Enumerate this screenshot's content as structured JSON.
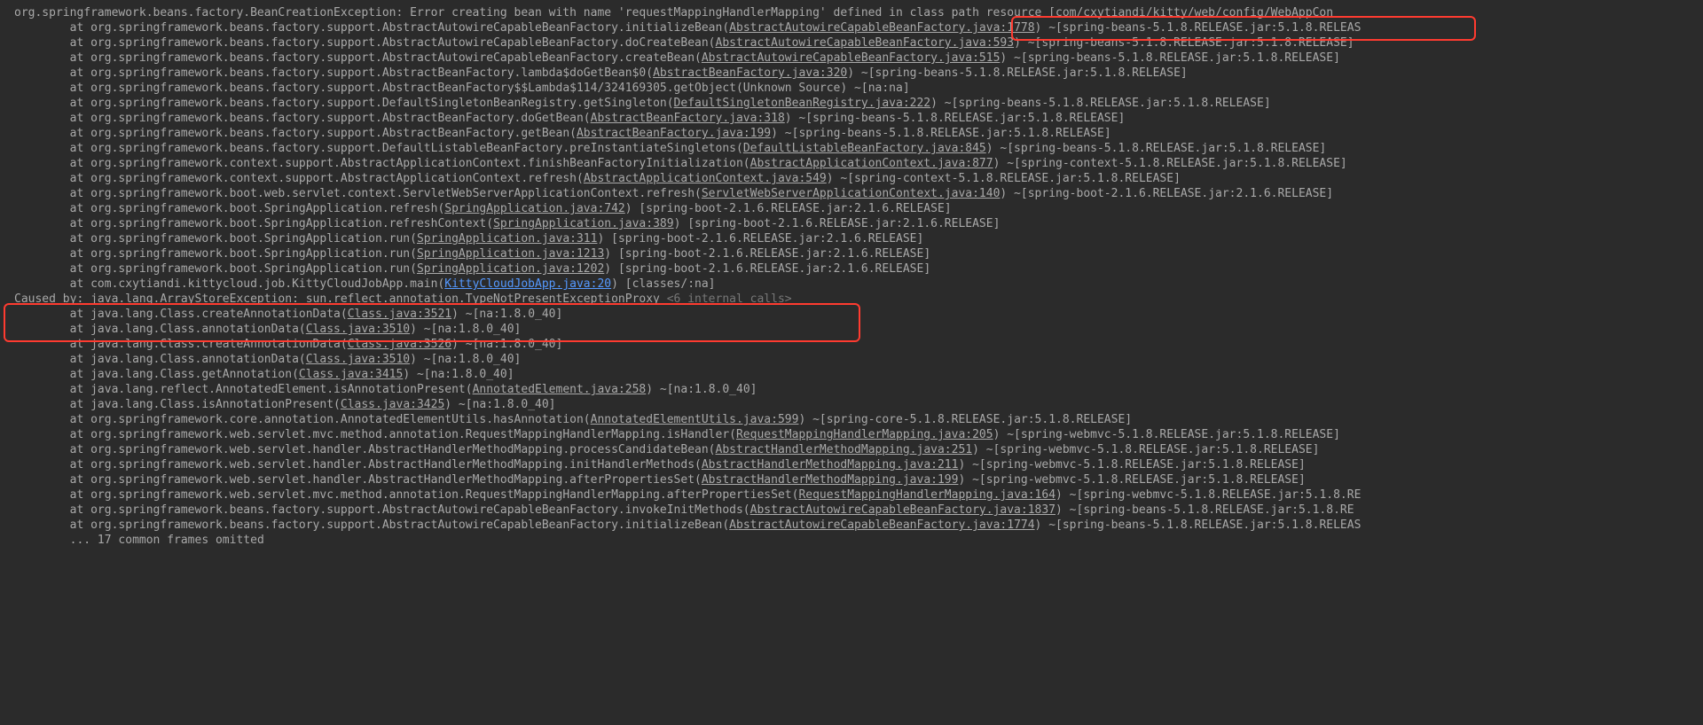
{
  "lines": [
    {
      "indent": 0,
      "segments": [
        {
          "t": "org.springframework.beans.factory.BeanCreationException: Error creating bean with name 'requestMappingHandlerMapping' defined in class path resource [com/cxytiandi/kitty/web/config/WebAppCon"
        }
      ]
    },
    {
      "indent": 2,
      "segments": [
        {
          "t": "at org.springframework.beans.factory.support.AbstractAutowireCapableBeanFactory.initializeBean("
        },
        {
          "t": "AbstractAutowireCapableBeanFactory.java:1778",
          "link": true
        },
        {
          "t": ") ~[spring-beans-5.1.8.RELEASE.jar:5.1.8.RELEAS"
        }
      ]
    },
    {
      "indent": 2,
      "segments": [
        {
          "t": "at org.springframework.beans.factory.support.AbstractAutowireCapableBeanFactory.doCreateBean("
        },
        {
          "t": "AbstractAutowireCapableBeanFactory.java:593",
          "link": true
        },
        {
          "t": ") ~[spring-beans-5.1.8.RELEASE.jar:5.1.8.RELEASE]"
        }
      ]
    },
    {
      "indent": 2,
      "segments": [
        {
          "t": "at org.springframework.beans.factory.support.AbstractAutowireCapableBeanFactory.createBean("
        },
        {
          "t": "AbstractAutowireCapableBeanFactory.java:515",
          "link": true
        },
        {
          "t": ") ~[spring-beans-5.1.8.RELEASE.jar:5.1.8.RELEASE]"
        }
      ]
    },
    {
      "indent": 2,
      "segments": [
        {
          "t": "at org.springframework.beans.factory.support.AbstractBeanFactory.lambda$doGetBean$0("
        },
        {
          "t": "AbstractBeanFactory.java:320",
          "link": true
        },
        {
          "t": ") ~[spring-beans-5.1.8.RELEASE.jar:5.1.8.RELEASE]"
        }
      ]
    },
    {
      "indent": 2,
      "segments": [
        {
          "t": "at org.springframework.beans.factory.support.AbstractBeanFactory$$Lambda$114/324169305.getObject(Unknown Source) ~[na:na]"
        }
      ]
    },
    {
      "indent": 2,
      "segments": [
        {
          "t": "at org.springframework.beans.factory.support.DefaultSingletonBeanRegistry.getSingleton("
        },
        {
          "t": "DefaultSingletonBeanRegistry.java:222",
          "link": true
        },
        {
          "t": ") ~[spring-beans-5.1.8.RELEASE.jar:5.1.8.RELEASE]"
        }
      ]
    },
    {
      "indent": 2,
      "segments": [
        {
          "t": "at org.springframework.beans.factory.support.AbstractBeanFactory.doGetBean("
        },
        {
          "t": "AbstractBeanFactory.java:318",
          "link": true
        },
        {
          "t": ") ~[spring-beans-5.1.8.RELEASE.jar:5.1.8.RELEASE]"
        }
      ]
    },
    {
      "indent": 2,
      "segments": [
        {
          "t": "at org.springframework.beans.factory.support.AbstractBeanFactory.getBean("
        },
        {
          "t": "AbstractBeanFactory.java:199",
          "link": true
        },
        {
          "t": ") ~[spring-beans-5.1.8.RELEASE.jar:5.1.8.RELEASE]"
        }
      ]
    },
    {
      "indent": 2,
      "segments": [
        {
          "t": "at org.springframework.beans.factory.support.DefaultListableBeanFactory.preInstantiateSingletons("
        },
        {
          "t": "DefaultListableBeanFactory.java:845",
          "link": true
        },
        {
          "t": ") ~[spring-beans-5.1.8.RELEASE.jar:5.1.8.RELEASE]"
        }
      ]
    },
    {
      "indent": 2,
      "segments": [
        {
          "t": "at org.springframework.context.support.AbstractApplicationContext.finishBeanFactoryInitialization("
        },
        {
          "t": "AbstractApplicationContext.java:877",
          "link": true
        },
        {
          "t": ") ~[spring-context-5.1.8.RELEASE.jar:5.1.8.RELEASE]"
        }
      ]
    },
    {
      "indent": 2,
      "segments": [
        {
          "t": "at org.springframework.context.support.AbstractApplicationContext.refresh("
        },
        {
          "t": "AbstractApplicationContext.java:549",
          "link": true
        },
        {
          "t": ") ~[spring-context-5.1.8.RELEASE.jar:5.1.8.RELEASE]"
        }
      ]
    },
    {
      "indent": 2,
      "segments": [
        {
          "t": "at org.springframework.boot.web.servlet.context.ServletWebServerApplicationContext.refresh("
        },
        {
          "t": "ServletWebServerApplicationContext.java:140",
          "link": true
        },
        {
          "t": ") ~[spring-boot-2.1.6.RELEASE.jar:2.1.6.RELEASE]"
        }
      ]
    },
    {
      "indent": 2,
      "segments": [
        {
          "t": "at org.springframework.boot.SpringApplication.refresh("
        },
        {
          "t": "SpringApplication.java:742",
          "link": true
        },
        {
          "t": ") [spring-boot-2.1.6.RELEASE.jar:2.1.6.RELEASE]"
        }
      ]
    },
    {
      "indent": 2,
      "segments": [
        {
          "t": "at org.springframework.boot.SpringApplication.refreshContext("
        },
        {
          "t": "SpringApplication.java:389",
          "link": true
        },
        {
          "t": ") [spring-boot-2.1.6.RELEASE.jar:2.1.6.RELEASE]"
        }
      ]
    },
    {
      "indent": 2,
      "segments": [
        {
          "t": "at org.springframework.boot.SpringApplication.run("
        },
        {
          "t": "SpringApplication.java:311",
          "link": true
        },
        {
          "t": ") [spring-boot-2.1.6.RELEASE.jar:2.1.6.RELEASE]"
        }
      ]
    },
    {
      "indent": 2,
      "segments": [
        {
          "t": "at org.springframework.boot.SpringApplication.run("
        },
        {
          "t": "SpringApplication.java:1213",
          "link": true
        },
        {
          "t": ") [spring-boot-2.1.6.RELEASE.jar:2.1.6.RELEASE]"
        }
      ]
    },
    {
      "indent": 2,
      "segments": [
        {
          "t": "at org.springframework.boot.SpringApplication.run("
        },
        {
          "t": "SpringApplication.java:1202",
          "link": true
        },
        {
          "t": ") [spring-boot-2.1.6.RELEASE.jar:2.1.6.RELEASE]"
        }
      ]
    },
    {
      "indent": 2,
      "segments": [
        {
          "t": "at com.cxytiandi.kittycloud.job.KittyCloudJobApp.main("
        },
        {
          "t": "KittyCloudJobApp.java:20",
          "linkBlue": true
        },
        {
          "t": ") [classes/:na]"
        }
      ]
    },
    {
      "indent": 0,
      "segments": [
        {
          "t": "Caused by: java.lang.ArrayStoreException: sun.reflect.annotation.TypeNotPresentExceptionProxy "
        },
        {
          "t": "<6 internal calls>",
          "faint": true
        }
      ]
    },
    {
      "indent": 2,
      "segments": [
        {
          "t": "at java.lang.Class.createAnnotationData("
        },
        {
          "t": "Class.java:3521",
          "link": true
        },
        {
          "t": ") ~[na:1.8.0_40]"
        }
      ]
    },
    {
      "indent": 2,
      "segments": [
        {
          "t": "at java.lang.Class.annotationData("
        },
        {
          "t": "Class.java:3510",
          "link": true
        },
        {
          "t": ") ~[na:1.8.0_40]"
        }
      ]
    },
    {
      "indent": 2,
      "segments": [
        {
          "t": "at java.lang.Class.createAnnotationData("
        },
        {
          "t": "Class.java:3526",
          "link": true
        },
        {
          "t": ") ~[na:1.8.0_40]"
        }
      ]
    },
    {
      "indent": 2,
      "segments": [
        {
          "t": "at java.lang.Class.annotationData("
        },
        {
          "t": "Class.java:3510",
          "link": true
        },
        {
          "t": ") ~[na:1.8.0_40]"
        }
      ]
    },
    {
      "indent": 2,
      "segments": [
        {
          "t": "at java.lang.Class.getAnnotation("
        },
        {
          "t": "Class.java:3415",
          "link": true
        },
        {
          "t": ") ~[na:1.8.0_40]"
        }
      ]
    },
    {
      "indent": 2,
      "segments": [
        {
          "t": "at java.lang.reflect.AnnotatedElement.isAnnotationPresent("
        },
        {
          "t": "AnnotatedElement.java:258",
          "link": true
        },
        {
          "t": ") ~[na:1.8.0_40]"
        }
      ]
    },
    {
      "indent": 2,
      "segments": [
        {
          "t": "at java.lang.Class.isAnnotationPresent("
        },
        {
          "t": "Class.java:3425",
          "link": true
        },
        {
          "t": ") ~[na:1.8.0_40]"
        }
      ]
    },
    {
      "indent": 2,
      "segments": [
        {
          "t": "at org.springframework.core.annotation.AnnotatedElementUtils.hasAnnotation("
        },
        {
          "t": "AnnotatedElementUtils.java:599",
          "link": true
        },
        {
          "t": ") ~[spring-core-5.1.8.RELEASE.jar:5.1.8.RELEASE]"
        }
      ]
    },
    {
      "indent": 2,
      "segments": [
        {
          "t": "at org.springframework.web.servlet.mvc.method.annotation.RequestMappingHandlerMapping.isHandler("
        },
        {
          "t": "RequestMappingHandlerMapping.java:205",
          "link": true
        },
        {
          "t": ") ~[spring-webmvc-5.1.8.RELEASE.jar:5.1.8.RELEASE]"
        }
      ]
    },
    {
      "indent": 2,
      "segments": [
        {
          "t": "at org.springframework.web.servlet.handler.AbstractHandlerMethodMapping.processCandidateBean("
        },
        {
          "t": "AbstractHandlerMethodMapping.java:251",
          "link": true
        },
        {
          "t": ") ~[spring-webmvc-5.1.8.RELEASE.jar:5.1.8.RELEASE]"
        }
      ]
    },
    {
      "indent": 2,
      "segments": [
        {
          "t": "at org.springframework.web.servlet.handler.AbstractHandlerMethodMapping.initHandlerMethods("
        },
        {
          "t": "AbstractHandlerMethodMapping.java:211",
          "link": true
        },
        {
          "t": ") ~[spring-webmvc-5.1.8.RELEASE.jar:5.1.8.RELEASE]"
        }
      ]
    },
    {
      "indent": 2,
      "segments": [
        {
          "t": "at org.springframework.web.servlet.handler.AbstractHandlerMethodMapping.afterPropertiesSet("
        },
        {
          "t": "AbstractHandlerMethodMapping.java:199",
          "link": true
        },
        {
          "t": ") ~[spring-webmvc-5.1.8.RELEASE.jar:5.1.8.RELEASE]"
        }
      ]
    },
    {
      "indent": 2,
      "segments": [
        {
          "t": "at org.springframework.web.servlet.mvc.method.annotation.RequestMappingHandlerMapping.afterPropertiesSet("
        },
        {
          "t": "RequestMappingHandlerMapping.java:164",
          "link": true
        },
        {
          "t": ") ~[spring-webmvc-5.1.8.RELEASE.jar:5.1.8.RE"
        }
      ]
    },
    {
      "indent": 2,
      "segments": [
        {
          "t": "at org.springframework.beans.factory.support.AbstractAutowireCapableBeanFactory.invokeInitMethods("
        },
        {
          "t": "AbstractAutowireCapableBeanFactory.java:1837",
          "link": true
        },
        {
          "t": ") ~[spring-beans-5.1.8.RELEASE.jar:5.1.8.RE"
        }
      ]
    },
    {
      "indent": 2,
      "segments": [
        {
          "t": "at org.springframework.beans.factory.support.AbstractAutowireCapableBeanFactory.initializeBean("
        },
        {
          "t": "AbstractAutowireCapableBeanFactory.java:1774",
          "link": true
        },
        {
          "t": ") ~[spring-beans-5.1.8.RELEASE.jar:5.1.8.RELEAS"
        }
      ]
    },
    {
      "indent": 2,
      "segments": [
        {
          "t": "... 17 common frames omitted"
        }
      ]
    }
  ]
}
